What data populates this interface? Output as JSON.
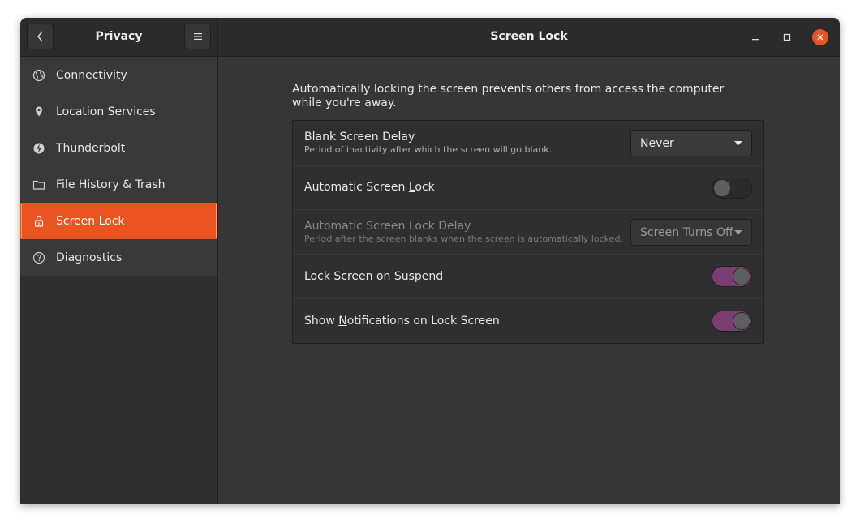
{
  "window": {
    "sidebar_title": "Privacy",
    "main_title": "Screen Lock"
  },
  "sidebar": {
    "items": [
      {
        "label": "Connectivity",
        "icon": "globe-icon"
      },
      {
        "label": "Location Services",
        "icon": "location-pin-icon"
      },
      {
        "label": "Thunderbolt",
        "icon": "thunderbolt-icon"
      },
      {
        "label": "File History & Trash",
        "icon": "folder-icon"
      },
      {
        "label": "Screen Lock",
        "icon": "lock-icon",
        "selected": true
      },
      {
        "label": "Diagnostics",
        "icon": "help-circle-icon"
      }
    ]
  },
  "main": {
    "description": "Automatically locking the screen prevents others from access the computer while you're away.",
    "rows": {
      "blank_delay": {
        "label": "Blank Screen Delay",
        "sublabel": "Period of inactivity after which the screen will go blank.",
        "value": "Never"
      },
      "auto_lock": {
        "label_pre": "Automatic Screen ",
        "label_mnemonic": "L",
        "label_post": "ock",
        "enabled": false
      },
      "auto_lock_delay": {
        "label": "Automatic Screen Lock Delay",
        "sublabel": "Period after the screen blanks when the screen is automatically locked.",
        "value": "Screen Turns Off"
      },
      "lock_on_suspend": {
        "label": "Lock Screen on Suspend",
        "enabled": true
      },
      "show_notifications": {
        "label_pre": "Show ",
        "label_mnemonic": "N",
        "label_post": "otifications on Lock Screen",
        "enabled": true
      }
    }
  },
  "colors": {
    "accent": "#e95420",
    "toggle_on": "#7a3e75"
  }
}
